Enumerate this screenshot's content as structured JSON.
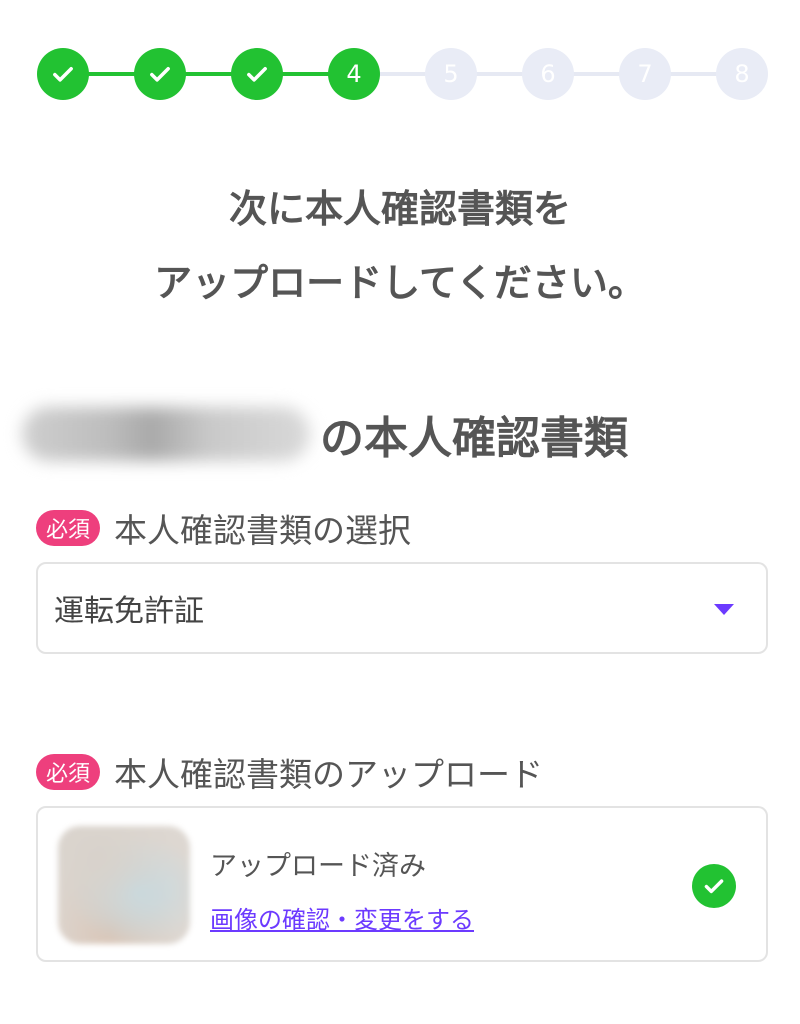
{
  "stepper": {
    "steps": [
      {
        "label": "",
        "state": "done"
      },
      {
        "label": "",
        "state": "done"
      },
      {
        "label": "",
        "state": "done"
      },
      {
        "label": "4",
        "state": "current"
      },
      {
        "label": "5",
        "state": "todo"
      },
      {
        "label": "6",
        "state": "todo"
      },
      {
        "label": "7",
        "state": "todo"
      },
      {
        "label": "8",
        "state": "todo"
      }
    ],
    "colors": {
      "done": "#22c232",
      "todo": "#e9ecf6"
    }
  },
  "heading": {
    "line1": "次に本人確認書類を",
    "line2": "アップロードしてください。"
  },
  "section": {
    "title_suffix": "の本人確認書類"
  },
  "document_select": {
    "required_badge": "必須",
    "label": "本人確認書類の選択",
    "selected_value": "運転免許証"
  },
  "document_upload": {
    "required_badge": "必須",
    "label": "本人確認書類のアップロード",
    "status": "アップロード済み",
    "link": "画像の確認・変更をする"
  },
  "colors": {
    "accent_green": "#22c232",
    "required_pink": "#ee3f7d",
    "link_purple": "#6c3aff"
  }
}
